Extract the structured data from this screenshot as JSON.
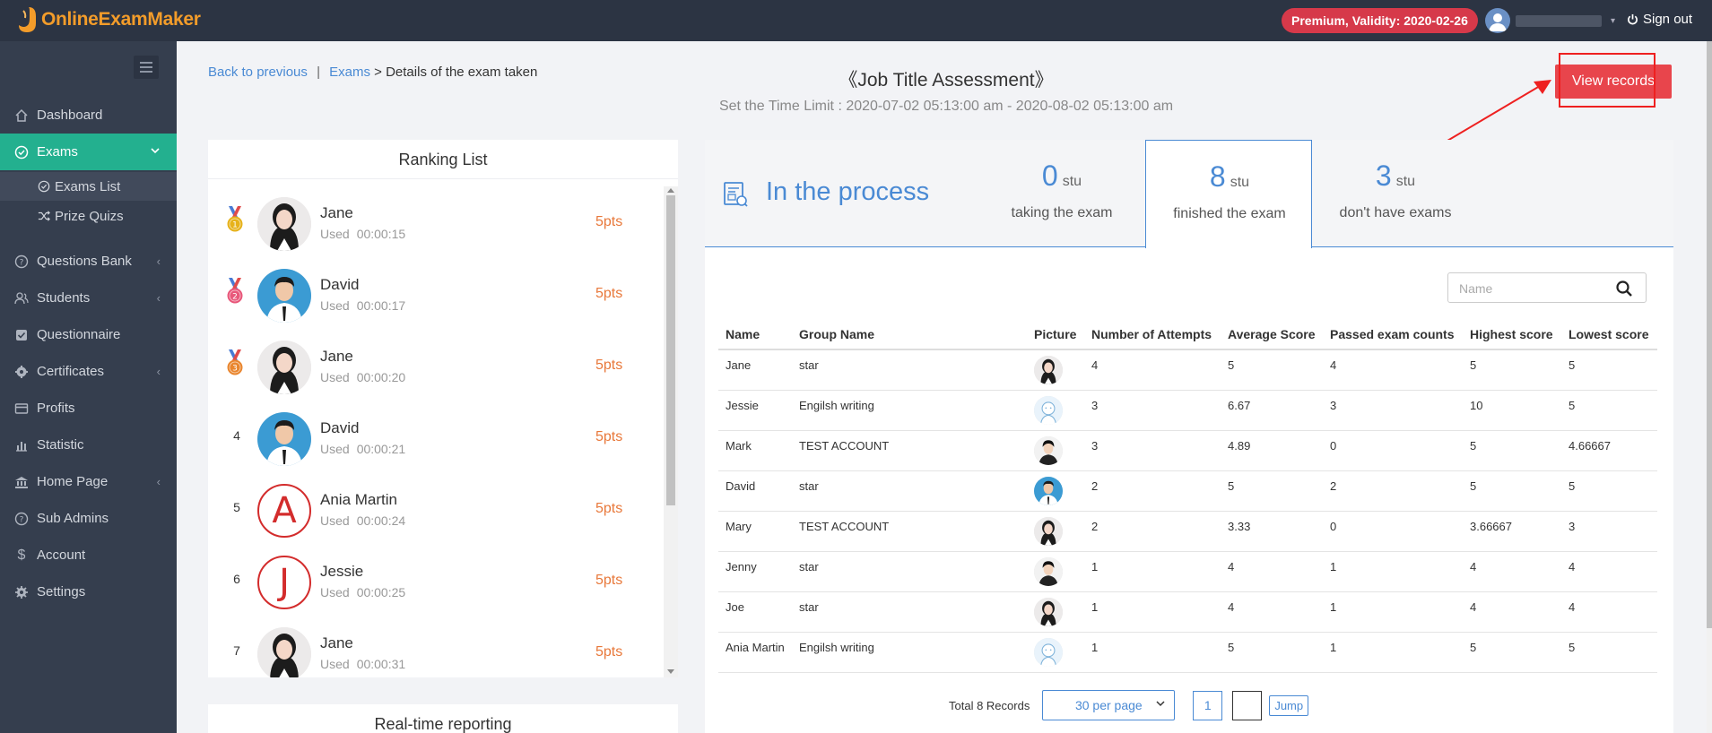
{
  "app": {
    "logo_text": "OnlineExamMaker"
  },
  "topbar": {
    "premium_label": "Premium, Validity: 2020-02-26",
    "signout_label": "Sign out"
  },
  "sidebar": {
    "items": [
      {
        "label": "Dashboard",
        "icon": "home-icon"
      },
      {
        "label": "Exams",
        "icon": "check-circle-icon"
      },
      {
        "label": "Questions Bank",
        "icon": "question-circle-icon"
      },
      {
        "label": "Students",
        "icon": "users-icon"
      },
      {
        "label": "Questionnaire",
        "icon": "check-square-icon"
      },
      {
        "label": "Certificates",
        "icon": "gear-badge-icon"
      },
      {
        "label": "Profits",
        "icon": "card-icon"
      },
      {
        "label": "Statistic",
        "icon": "bar-chart-icon"
      },
      {
        "label": "Home Page",
        "icon": "bank-icon"
      },
      {
        "label": "Sub Admins",
        "icon": "question-circle-icon"
      },
      {
        "label": "Account",
        "icon": "dollar-icon"
      },
      {
        "label": "Settings",
        "icon": "gear-icon"
      }
    ],
    "sub_items": [
      {
        "label": "Exams List",
        "icon": "check-circle-icon"
      },
      {
        "label": "Prize Quizs",
        "icon": "shuffle-icon"
      }
    ]
  },
  "breadcrumb": {
    "back": "Back to previous",
    "sep": "|",
    "exams": "Exams",
    "arrow": ">",
    "current": "Details of the exam taken"
  },
  "exam": {
    "title": "《Job Title Assessment》",
    "time_limit": "Set the Time Limit : 2020-07-02 05:13:00 am - 2020-08-02 05:13:00 am",
    "view_records_label": "View records"
  },
  "ranking": {
    "title": "Ranking List",
    "used_label": "Used",
    "rows": [
      {
        "rank": "1",
        "name": "Jane",
        "time": "00:00:15",
        "points": "5pts"
      },
      {
        "rank": "2",
        "name": "David",
        "time": "00:00:17",
        "points": "5pts"
      },
      {
        "rank": "3",
        "name": "Jane",
        "time": "00:00:20",
        "points": "5pts"
      },
      {
        "rank": "4",
        "name": "David",
        "time": "00:00:21",
        "points": "5pts"
      },
      {
        "rank": "5",
        "name": "Ania Martin",
        "time": "00:00:24",
        "points": "5pts",
        "letter": "A"
      },
      {
        "rank": "6",
        "name": "Jessie",
        "time": "00:00:25",
        "points": "5pts",
        "letter": "J"
      },
      {
        "rank": "7",
        "name": "Jane",
        "time": "00:00:31",
        "points": "5pts"
      }
    ]
  },
  "realtime": {
    "title": "Real-time reporting"
  },
  "status": {
    "label": "In the process",
    "stats": [
      {
        "value": "0",
        "unit": "stu",
        "label": "taking the exam"
      },
      {
        "value": "8",
        "unit": "stu",
        "label": "finished the exam"
      },
      {
        "value": "3",
        "unit": "stu",
        "label": "don't have exams"
      }
    ]
  },
  "search": {
    "placeholder": "Name"
  },
  "table": {
    "headers": [
      "Name",
      "Group Name",
      "Picture",
      "Number of Attempts",
      "Average Score",
      "Passed exam counts",
      "Highest score",
      "Lowest score"
    ],
    "rows": [
      [
        "Jane",
        "star",
        "",
        "4",
        "5",
        "4",
        "5",
        "5"
      ],
      [
        "Jessie",
        "Engilsh writing",
        "",
        "3",
        "6.67",
        "3",
        "10",
        "5"
      ],
      [
        "Mark",
        "TEST ACCOUNT",
        "",
        "3",
        "4.89",
        "0",
        "5",
        "4.66667"
      ],
      [
        "David",
        "star",
        "",
        "2",
        "5",
        "2",
        "5",
        "5"
      ],
      [
        "Mary",
        "TEST ACCOUNT",
        "",
        "2",
        "3.33",
        "0",
        "3.66667",
        "3"
      ],
      [
        "Jenny",
        "star",
        "",
        "1",
        "4",
        "1",
        "4",
        "4"
      ],
      [
        "Joe",
        "star",
        "",
        "1",
        "4",
        "1",
        "4",
        "4"
      ],
      [
        "Ania Martin",
        "Engilsh writing",
        "",
        "1",
        "5",
        "1",
        "5",
        "5"
      ]
    ]
  },
  "pagination": {
    "total": "Total 8 Records",
    "per_page": "30 per page",
    "current_page": "1",
    "jump": "Jump"
  },
  "colors": {
    "accent": "#4a8ad4",
    "active_nav": "#23b08f",
    "danger": "#e8454c",
    "points": "#e8783a"
  }
}
